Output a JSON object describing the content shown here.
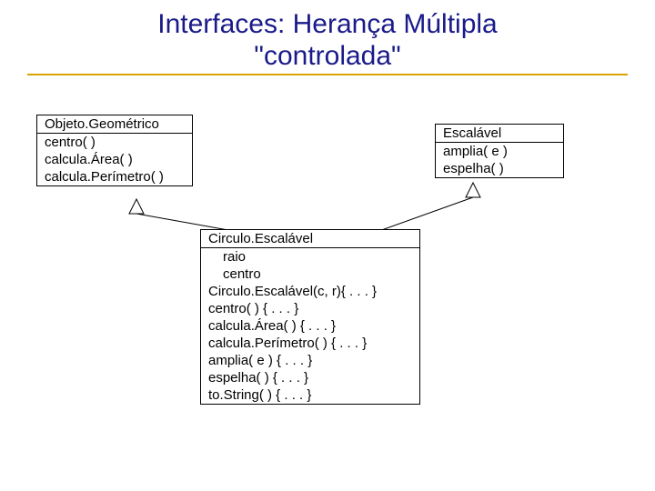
{
  "title": {
    "line1": "Interfaces: Herança Múltipla",
    "line2": "\"controlada\""
  },
  "boxes": {
    "geo": {
      "name": "Objeto.Geométrico",
      "methods": [
        "centro( )",
        "calcula.Área( )",
        "calcula.Perímetro( )"
      ]
    },
    "esc": {
      "name": "Escalável",
      "methods": [
        "amplia( e )",
        "espelha( )"
      ]
    },
    "circ": {
      "name": "Circulo.Escalável",
      "attrs": [
        "raio",
        "centro"
      ],
      "methods": [
        "Circulo.Escalável(c, r){ . . . }",
        "centro( ) { . . . }",
        "calcula.Área( ) { . . . }",
        "calcula.Perímetro( ) { . . . }",
        "amplia( e ) { . . . }",
        "espelha( ) { . . . }",
        "to.String( ) { . . . }"
      ]
    }
  }
}
